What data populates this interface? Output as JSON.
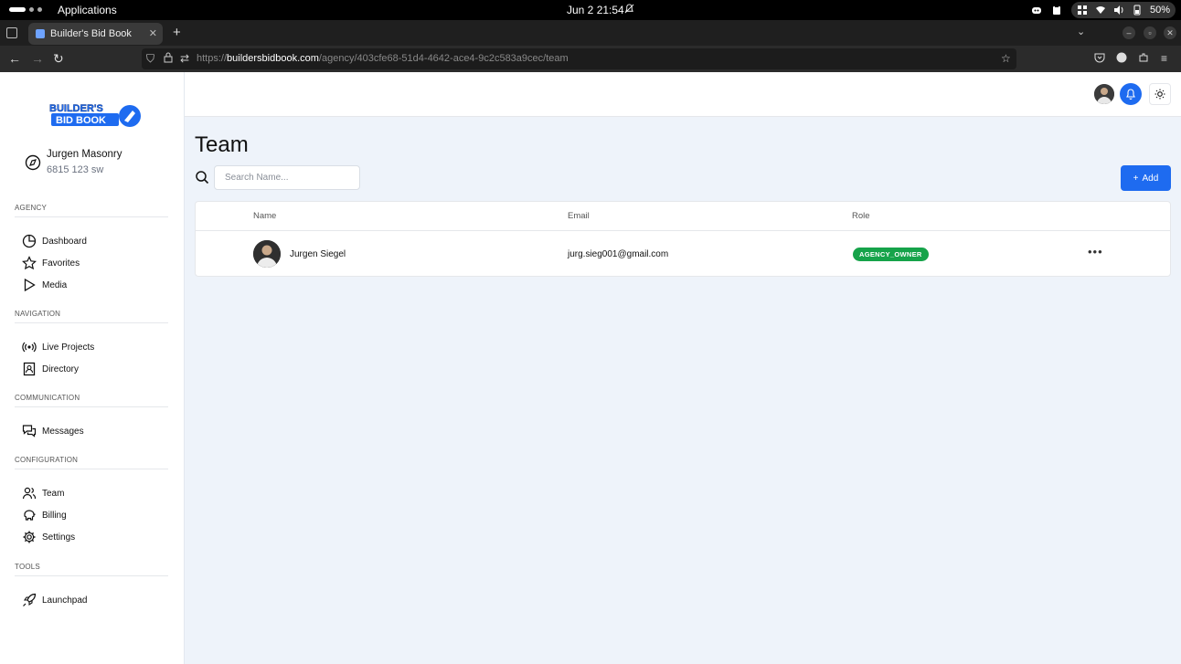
{
  "os": {
    "apps_label": "Applications",
    "clock": "Jun 2  21:54",
    "battery": "50%"
  },
  "browser": {
    "tab_title": "Builder's Bid Book",
    "url_prefix": "https://",
    "url_domain": "buildersbidbook.com",
    "url_path": "/agency/403cfe68-51d4-4642-ace4-9c2c583a9cec/team"
  },
  "sidebar": {
    "logo_line1": "BUILDER'S",
    "logo_line2": "BID BOOK",
    "account_name": "Jurgen Masonry",
    "account_address": "6815 123 sw",
    "sections": {
      "agency": "AGENCY",
      "navigation": "NAVIGATION",
      "communication": "COMMUNICATION",
      "configuration": "CONFIGURATION",
      "tools": "TOOLS"
    },
    "items": {
      "dashboard": "Dashboard",
      "favorites": "Favorites",
      "media": "Media",
      "live_projects": "Live Projects",
      "directory": "Directory",
      "messages": "Messages",
      "team": "Team",
      "billing": "Billing",
      "settings": "Settings",
      "launchpad": "Launchpad"
    }
  },
  "main": {
    "title": "Team",
    "search_placeholder": "Search Name...",
    "add_label": "Add",
    "columns": {
      "name": "Name",
      "email": "Email",
      "role": "Role"
    },
    "rows": [
      {
        "name": "Jurgen Siegel",
        "email": "jurg.sieg001@gmail.com",
        "role": "AGENCY_OWNER"
      }
    ]
  },
  "colors": {
    "accent": "#1e6bf0",
    "role_badge": "#16a34a",
    "background": "#eef3fa"
  }
}
